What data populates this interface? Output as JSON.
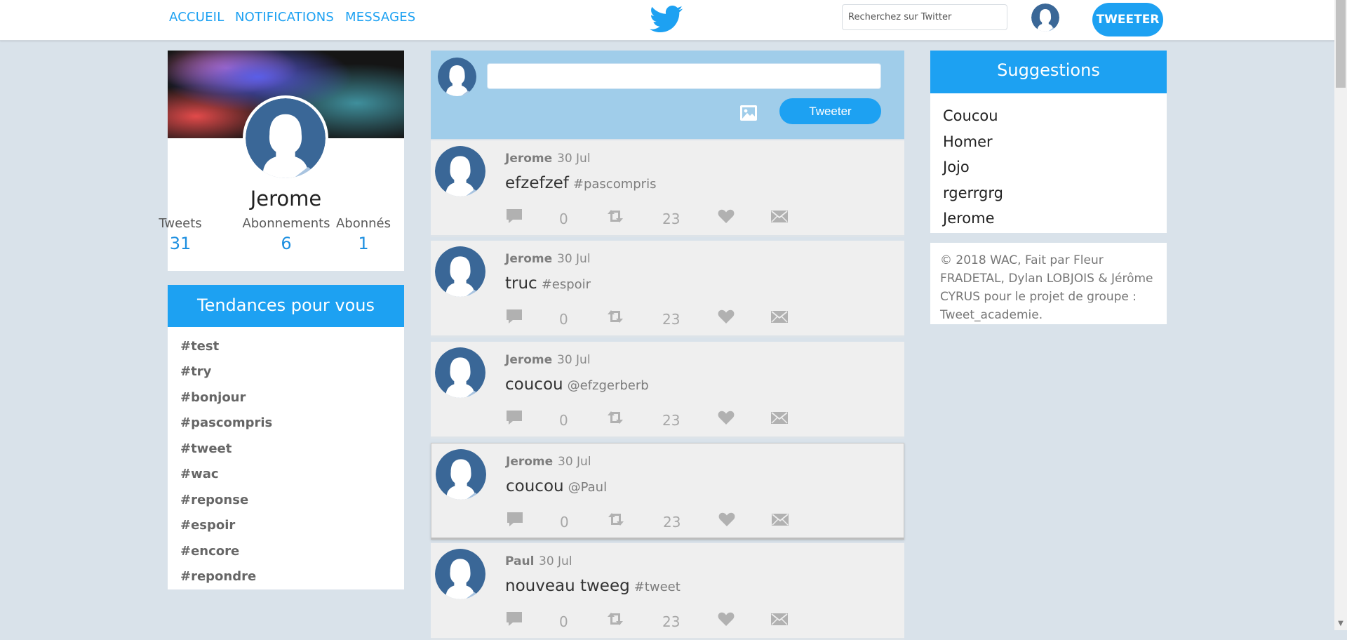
{
  "nav": {
    "home": "ACCUEIL",
    "notifications": "NOTIFICATIONS",
    "messages": "MESSAGES",
    "search_placeholder": "Recherchez sur Twitter",
    "tweet_button": "TWEETER"
  },
  "profile": {
    "name": "Jerome",
    "stats": [
      {
        "label": "Tweets",
        "value": "31"
      },
      {
        "label": "Abonnements",
        "value": "6"
      },
      {
        "label": "Abonnés",
        "value": "1"
      }
    ]
  },
  "trends": {
    "title": "Tendances pour vous",
    "items": [
      "#test",
      "#try",
      "#bonjour",
      "#pascompris",
      "#tweet",
      "#wac",
      "#reponse",
      "#espoir",
      "#encore",
      "#repondre"
    ]
  },
  "compose": {
    "button": "Tweeter"
  },
  "tweets": [
    {
      "author": "Jerome",
      "date": "30 Jul",
      "text": "efzefzef",
      "tag": "#pascompris",
      "replies": "0",
      "retweets": "23"
    },
    {
      "author": "Jerome",
      "date": "30 Jul",
      "text": "truc",
      "tag": "#espoir",
      "replies": "0",
      "retweets": "23"
    },
    {
      "author": "Jerome",
      "date": "30 Jul",
      "text": "coucou",
      "tag": "@efzgerberb",
      "replies": "0",
      "retweets": "23"
    },
    {
      "author": "Jerome",
      "date": "30 Jul",
      "text": "coucou",
      "tag": "@Paul",
      "replies": "0",
      "retweets": "23"
    },
    {
      "author": "Paul",
      "date": "30 Jul",
      "text": "nouveau tweeg",
      "tag": "#tweet",
      "replies": "0",
      "retweets": "23"
    }
  ],
  "suggestions": {
    "title": "Suggestions",
    "items": [
      "Coucou",
      "Homer",
      "Jojo",
      "rgerrgrg",
      "Jerome"
    ]
  },
  "footer": {
    "text": "© 2018 WAC, Fait par Fleur FRADETAL, Dylan LOBJOIS & Jérôme CYRUS pour le projet de groupe : Tweet_academie."
  },
  "colors": {
    "accent": "#1da1f2",
    "compose_bg": "#a0cdea",
    "page_bg": "#d9e2ea",
    "tweet_bg": "#efefef",
    "avatar_blue": "#3a6797"
  }
}
